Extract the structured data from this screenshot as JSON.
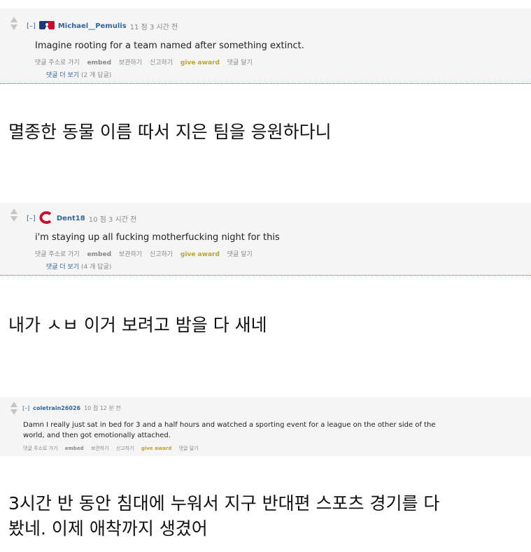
{
  "comments": [
    {
      "collapse": "[–]",
      "author": "Michael__Pemulis",
      "time": "11 점 3 시간 전",
      "body": "Imagine rooting for a team named after something extinct.",
      "actions": [
        "댓글 주소로 가기",
        "embed",
        "보관하기",
        "신고하기",
        "give award",
        "댓글 달기"
      ],
      "more": "댓글 더 보기",
      "more_count": "(2 개 답글)"
    },
    {
      "collapse": "[–]",
      "author": "Dent18",
      "time": "10 점 3 시간 전",
      "body": "i'm staying up all fucking motherfucking night for this",
      "actions": [
        "댓글 주소로 가기",
        "embed",
        "보관하기",
        "신고하기",
        "give award",
        "댓글 달기"
      ],
      "more": "댓글 더 보기",
      "more_count": "(4 개 답글)"
    },
    {
      "collapse": "[–]",
      "author": "coletrain26026",
      "time": "10 점 12 분 전",
      "body_line1": "Damn I really just sat in bed for 3 and a half hours and watched a sporting event for a league on the other side of the",
      "body_line2": "world, and then got emotionally attached.",
      "actions": [
        "댓글 주소로 가기",
        "embed",
        "보관하기",
        "신고하기",
        "give award",
        "댓글 달기"
      ]
    }
  ],
  "captions": {
    "c1": "멸종한 동물 이름 따서 지은 팀을 응원하다니",
    "c2": "내가 ㅅㅂ 이거 보려고 밤을 다 새네",
    "c3_line1": "3시간 반 동안 침대에 누워서 지구 반대편 스포츠 경기를 다",
    "c3_line2": "봤네. 이제 애착까지 생겼어"
  },
  "colors": {
    "link": "#336699",
    "award": "#b8a33a",
    "divider": "#dd3333"
  }
}
